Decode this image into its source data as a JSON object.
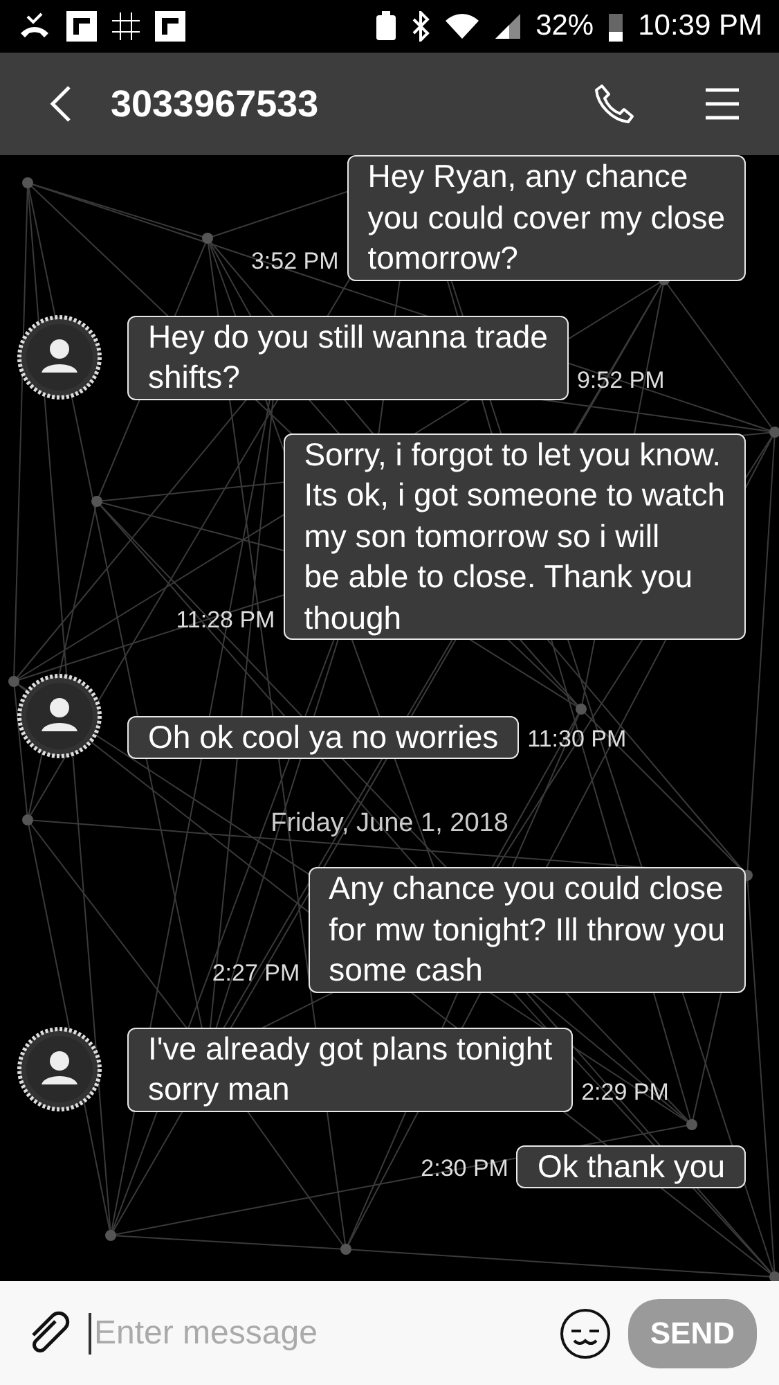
{
  "status_bar": {
    "battery": "32%",
    "time": "10:39 PM"
  },
  "header": {
    "title": "3033967533"
  },
  "messages": [
    {
      "kind": "sent",
      "lines": [
        "Hey Ryan, any chance",
        "you could cover my close",
        "tomorrow?"
      ],
      "time": "3:52 PM"
    },
    {
      "kind": "received",
      "lines": [
        "Hey do you still wanna trade",
        "shifts?"
      ],
      "time": "9:52 PM"
    },
    {
      "kind": "sent",
      "lines": [
        "Sorry, i forgot to let you know.",
        "Its ok, i got someone to watch",
        "my son tomorrow so i will",
        "be able to close. Thank you",
        "though"
      ],
      "time": "11:28 PM"
    },
    {
      "kind": "received",
      "lines": [
        "Oh ok cool ya no worries"
      ],
      "time": "11:30 PM"
    },
    {
      "kind": "date",
      "text": "Friday, June 1, 2018"
    },
    {
      "kind": "sent",
      "lines": [
        "Any chance you could close",
        "for mw tonight? Ill throw you",
        "some cash"
      ],
      "time": "2:27 PM"
    },
    {
      "kind": "received",
      "lines": [
        "I've already got plans tonight",
        "sorry man"
      ],
      "time": "2:29 PM"
    },
    {
      "kind": "sent",
      "lines": [
        "Ok thank you"
      ],
      "time": "2:30 PM"
    }
  ],
  "composer": {
    "placeholder": "Enter message",
    "send": "SEND"
  }
}
